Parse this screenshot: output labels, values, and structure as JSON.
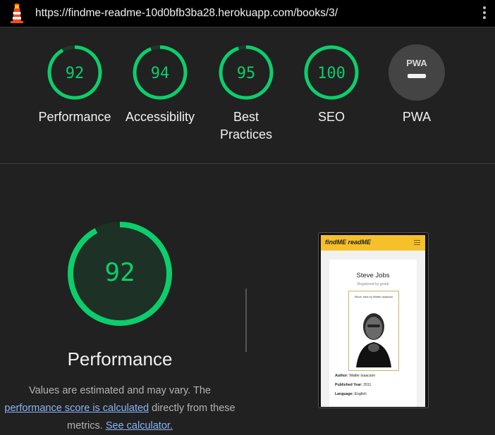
{
  "browser": {
    "url": "https://findme-readme-10d0bfb3ba28.herokuapp.com/books/3/",
    "logo_icon": "lighthouse-icon",
    "menu_icon": "kebab-menu-icon"
  },
  "colors": {
    "pass": "#0cce6b",
    "pass_fill": "#1e3a2a",
    "pwa_gray": "#444444",
    "background": "#212121"
  },
  "gauges": [
    {
      "label": "Performance",
      "score": 92
    },
    {
      "label": "Accessibility",
      "score": 94
    },
    {
      "label": "Best Practices",
      "score": 95
    },
    {
      "label": "SEO",
      "score": 100
    },
    {
      "label": "PWA",
      "score": null,
      "badge": "PWA"
    }
  ],
  "performance": {
    "score": 92,
    "title": "Performance",
    "desc_1": "Values are estimated and may vary. The",
    "desc_link_1": "performance score is calculated",
    "desc_2": " directly from these",
    "desc_3": "metrics. ",
    "desc_link_2": "See calculator."
  },
  "screenshot": {
    "brand": "findME readME",
    "book_title": "Steve Jobs",
    "registered": "Registered by grobb",
    "cover_caption": "Steve Jobs by Walter Isaacson",
    "author_label": "Author:",
    "author": "Walter Isaacson",
    "year_label": "Published Year:",
    "year": "2011",
    "language_label": "Language:",
    "language": "English"
  }
}
